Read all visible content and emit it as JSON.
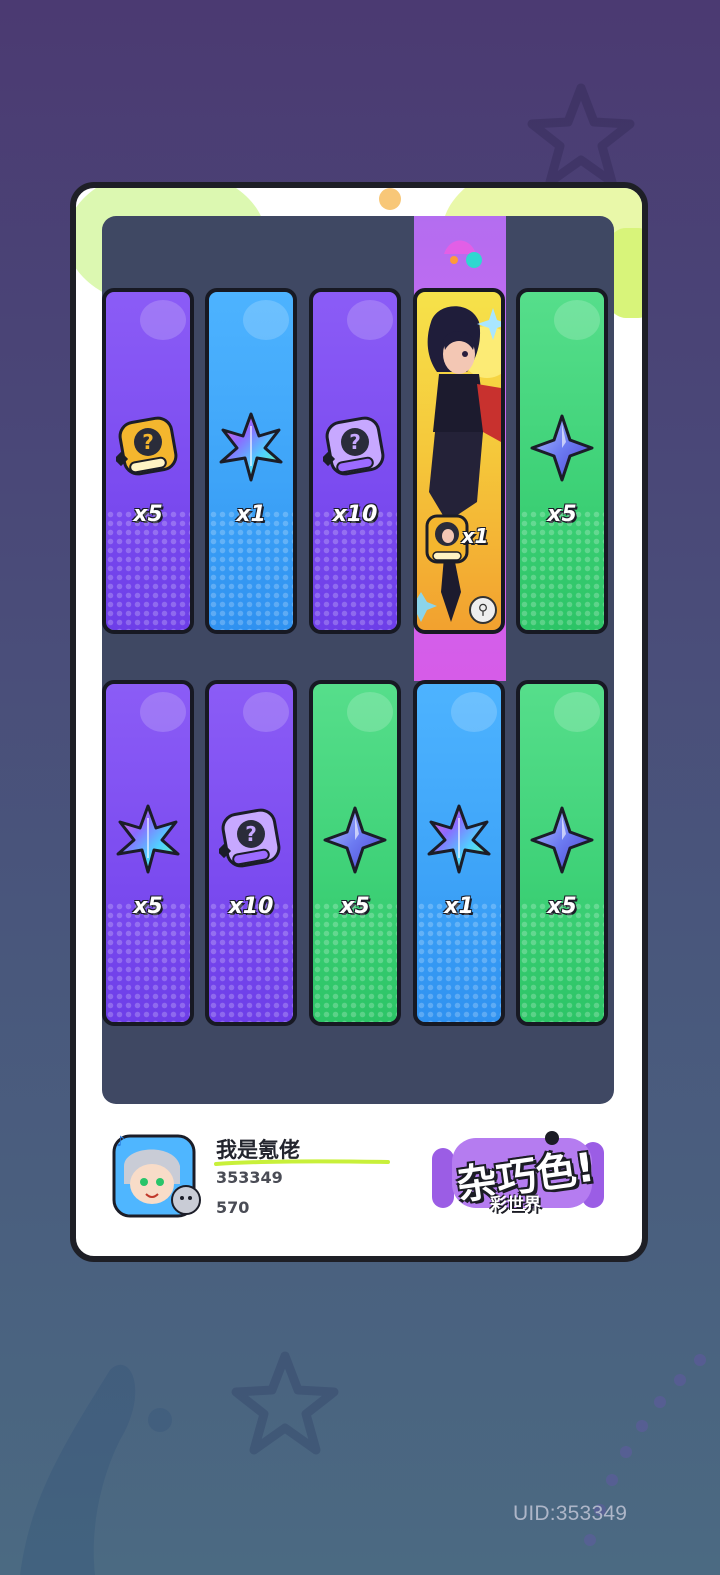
{
  "colors": {
    "background_top": "#4b3a72",
    "background_bottom": "#4b6a82",
    "board": "#3f4863",
    "card_purple": "#8b5cf6",
    "card_blue": "#4db3ff",
    "card_green": "#56de8b",
    "highlight": "#c869f2",
    "featured_card": "#f5c63a"
  },
  "row1": [
    {
      "color": "purple",
      "icon": "mystery-badge-icon",
      "quantity": "x5"
    },
    {
      "color": "blue",
      "icon": "rainbow-leaf-icon",
      "quantity": "x1"
    },
    {
      "color": "purple",
      "icon": "mystery-badge-icon",
      "quantity": "x10"
    },
    {
      "color": "featured",
      "icon": "character-portrait",
      "quantity": "x1"
    },
    {
      "color": "green",
      "icon": "blue-star-crystal-icon",
      "quantity": "x5"
    }
  ],
  "row2": [
    {
      "color": "purple",
      "icon": "rainbow-leaf-icon",
      "quantity": "x5"
    },
    {
      "color": "purple",
      "icon": "mystery-badge-icon",
      "quantity": "x10"
    },
    {
      "color": "green",
      "icon": "blue-star-crystal-icon",
      "quantity": "x5"
    },
    {
      "color": "blue",
      "icon": "rainbow-leaf-icon",
      "quantity": "x1"
    },
    {
      "color": "green",
      "icon": "blue-star-crystal-icon",
      "quantity": "x5"
    }
  ],
  "player": {
    "name": "我是氪佬",
    "id": "353349",
    "score": "570"
  },
  "logo": {
    "main": "杂巧色!",
    "sub": "彩世界"
  },
  "uid_label": "UID:353349"
}
